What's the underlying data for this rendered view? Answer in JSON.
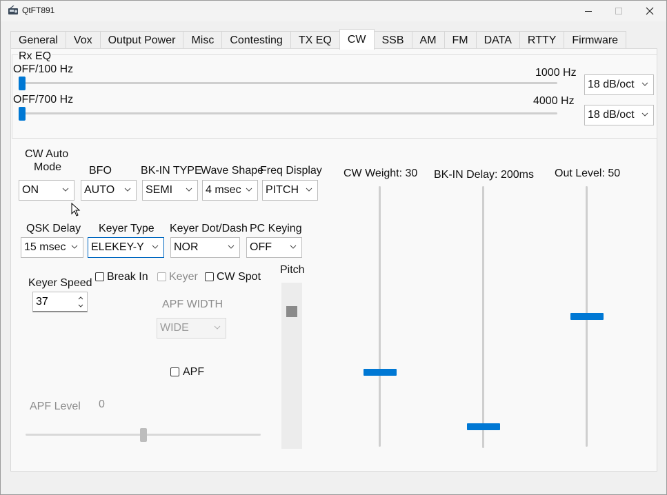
{
  "window": {
    "title": "QtFT891"
  },
  "tabs": [
    "General",
    "Vox",
    "Output Power",
    "Misc",
    "Contesting",
    "TX EQ",
    "CW",
    "SSB",
    "AM",
    "FM",
    "DATA",
    "RTTY",
    "Firmware"
  ],
  "active_tab": "CW",
  "rx_eq": {
    "title": "Rx EQ",
    "row1": {
      "left_label": "OFF/100 Hz",
      "right_label": "1000 Hz",
      "slope": "18 dB/oct",
      "value": 0
    },
    "row2": {
      "left_label": "OFF/700 Hz",
      "right_label": "4000 Hz",
      "slope": "18 dB/oct",
      "value": 0
    }
  },
  "cw_auto_mode": {
    "label_line1": "CW Auto",
    "label_line2": "Mode",
    "value": "ON"
  },
  "bfo": {
    "label": "BFO",
    "value": "AUTO"
  },
  "bk_in_type": {
    "label": "BK-IN TYPE",
    "value": "SEMI"
  },
  "wave_shape": {
    "label": "Wave Shape",
    "value": "4 msec"
  },
  "freq_display": {
    "label": "Freq Display",
    "value": "PITCH"
  },
  "qsk_delay": {
    "label": "QSK Delay",
    "value": "15 msec"
  },
  "keyer_type": {
    "label": "Keyer Type",
    "value": "ELEKEY-Y"
  },
  "keyer_dot_dash": {
    "label": "Keyer Dot/Dash",
    "value": "NOR"
  },
  "pc_keying": {
    "label": "PC Keying",
    "value": "OFF"
  },
  "keyer_speed": {
    "label": "Keyer Speed",
    "value": "37"
  },
  "checks": {
    "break_in": "Break In",
    "keyer": "Keyer",
    "cw_spot": "CW Spot",
    "apf": "APF"
  },
  "apf_width": {
    "label": "APF WIDTH",
    "value": "WIDE"
  },
  "apf_level": {
    "label": "APF Level",
    "value": "0",
    "position": 0.5
  },
  "pitch": {
    "label": "Pitch",
    "position": 0.85
  },
  "cw_weight": {
    "label": "CW Weight: 30",
    "position": 0.28
  },
  "bk_in_delay": {
    "label": "BK-IN Delay: 200ms",
    "position": 0.07
  },
  "out_level": {
    "label": "Out Level: 50",
    "position": 0.5
  },
  "colors": {
    "accent": "#0078d4",
    "disabled_handle": "#8a8a8a"
  }
}
